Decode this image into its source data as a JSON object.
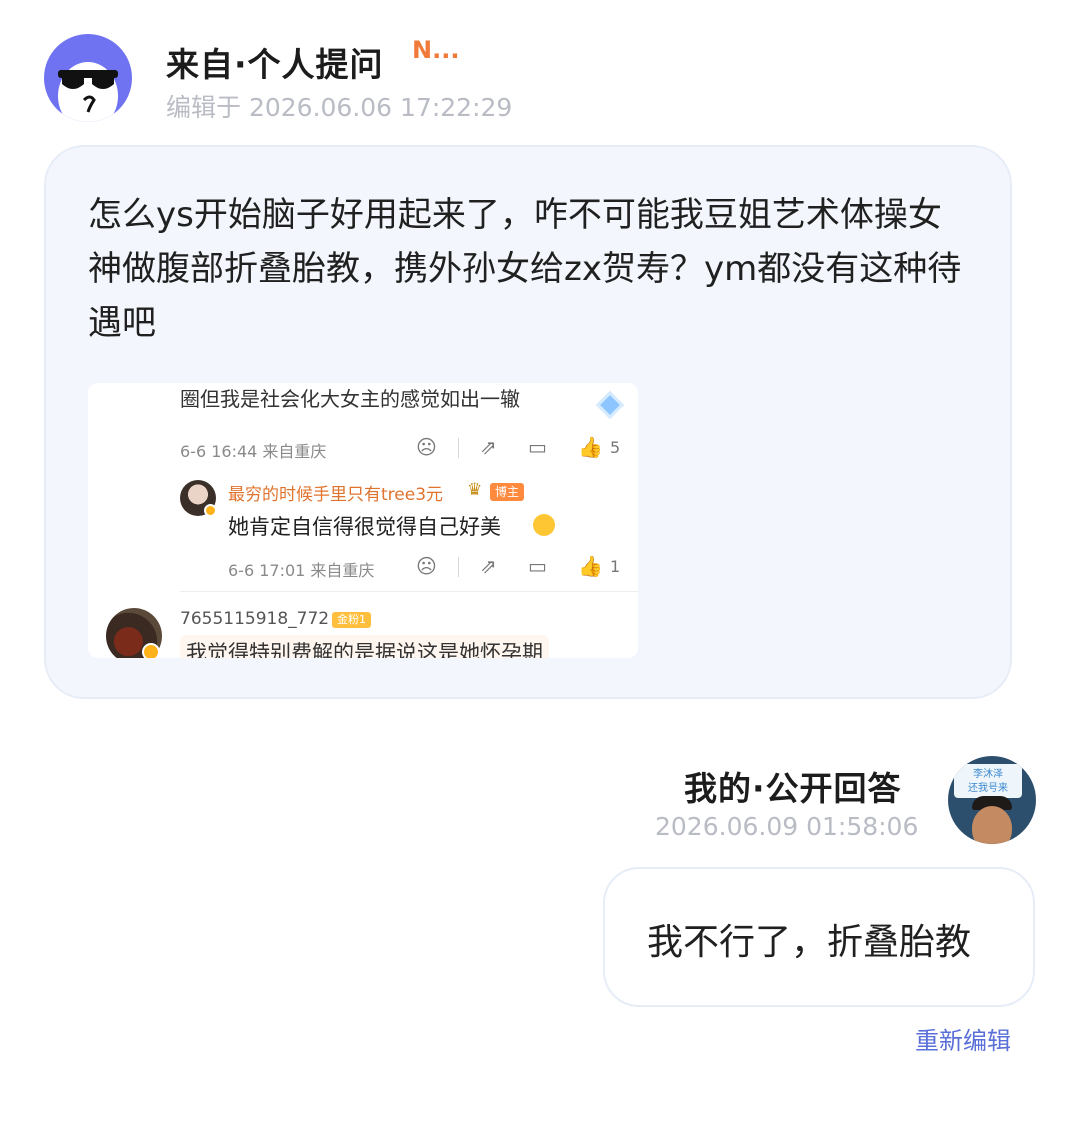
{
  "question": {
    "title": "来自·个人提问",
    "badge": "N...",
    "edited_time": "编辑于 2026.06.06 17:22:29",
    "text": "怎么ys开始脑子好用起来了，咋不可能我豆姐艺术体操女神做腹部折叠胎教，携外孙女给zx贺寿？ym都没有这种待遇吧",
    "avatar_icon": "sunglasses-face-icon",
    "screenshot": {
      "line1": "圈但我是社会化大女主的感觉如出一辙",
      "comment1_meta": "6-6 16:44 来自重庆",
      "comment1_likes": "5",
      "reply_user": "最穷的时候手里只有tree3元",
      "reply_tag": "博主",
      "reply_text": "她肯定自信得很觉得自己好美",
      "reply_meta": "6-6 17:01 来自重庆",
      "reply_likes": "1",
      "user3": "7655115918_772",
      "user3_badge": "金粉1",
      "user3_text_cut": "我觉得特别费解的是据说这是她怀孕期"
    }
  },
  "answer": {
    "title": "我的·公开回答",
    "time": "2026.06.09 01:58:06",
    "avatar_sign_text": "李沐泽\n还我号来",
    "text": "我不行了，折叠胎教",
    "reedit_label": "重新编辑"
  },
  "colors": {
    "accent_orange": "#f07a3a",
    "link_blue": "#5b6fd8",
    "avatar_purple": "#6f73f2",
    "bubble_bg": "#f3f7fd"
  }
}
